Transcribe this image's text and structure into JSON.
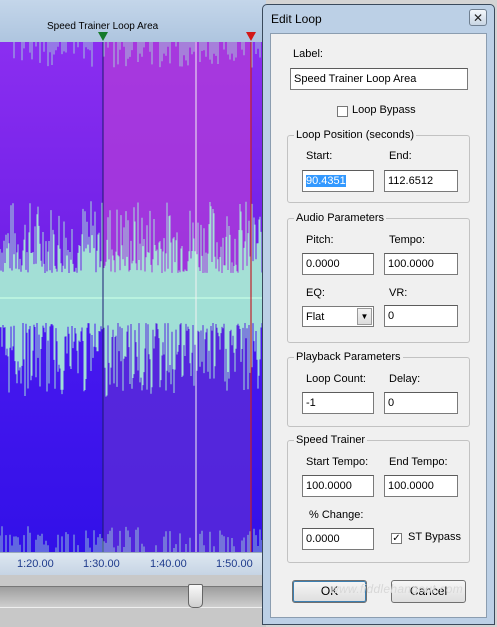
{
  "editor": {
    "loop_label": "Speed Trainer Loop Area",
    "time_ticks": [
      "1:20.00",
      "1:30.00",
      "1:40.00",
      "1:50.00"
    ]
  },
  "dialog": {
    "title": "Edit Loop",
    "close_glyph": "✕",
    "label_caption": "Label:",
    "label_value": "Speed Trainer Loop Area",
    "loop_bypass": {
      "label": "Loop Bypass",
      "checked": false
    },
    "loop_position": {
      "title": "Loop Position (seconds)",
      "start_label": "Start:",
      "start_value": "90.4351",
      "end_label": "End:",
      "end_value": "112.6512"
    },
    "audio": {
      "title": "Audio Parameters",
      "pitch_label": "Pitch:",
      "pitch_value": "0.0000",
      "tempo_label": "Tempo:",
      "tempo_value": "100.0000",
      "eq_label": "EQ:",
      "eq_value": "Flat",
      "vr_label": "VR:",
      "vr_value": "0"
    },
    "playback": {
      "title": "Playback Parameters",
      "loop_count_label": "Loop Count:",
      "loop_count_value": "-1",
      "delay_label": "Delay:",
      "delay_value": "0"
    },
    "speed_trainer": {
      "title": "Speed Trainer",
      "start_tempo_label": "Start Tempo:",
      "start_tempo_value": "100.0000",
      "end_tempo_label": "End Tempo:",
      "end_tempo_value": "100.0000",
      "change_label": "% Change:",
      "change_value": "0.0000",
      "st_bypass": {
        "label": "ST Bypass",
        "checked": true,
        "glyph": "✓"
      }
    },
    "ok_label": "OK",
    "cancel_label": "Cancel"
  },
  "watermark": "www.fiddlehangout.com",
  "colors": {
    "wave_outer": "#7a1fe0",
    "wave_loop": "#a43ad8",
    "wave_fill": "#a6ead6",
    "marker_start": "#157a2a",
    "marker_end": "#d21818"
  }
}
